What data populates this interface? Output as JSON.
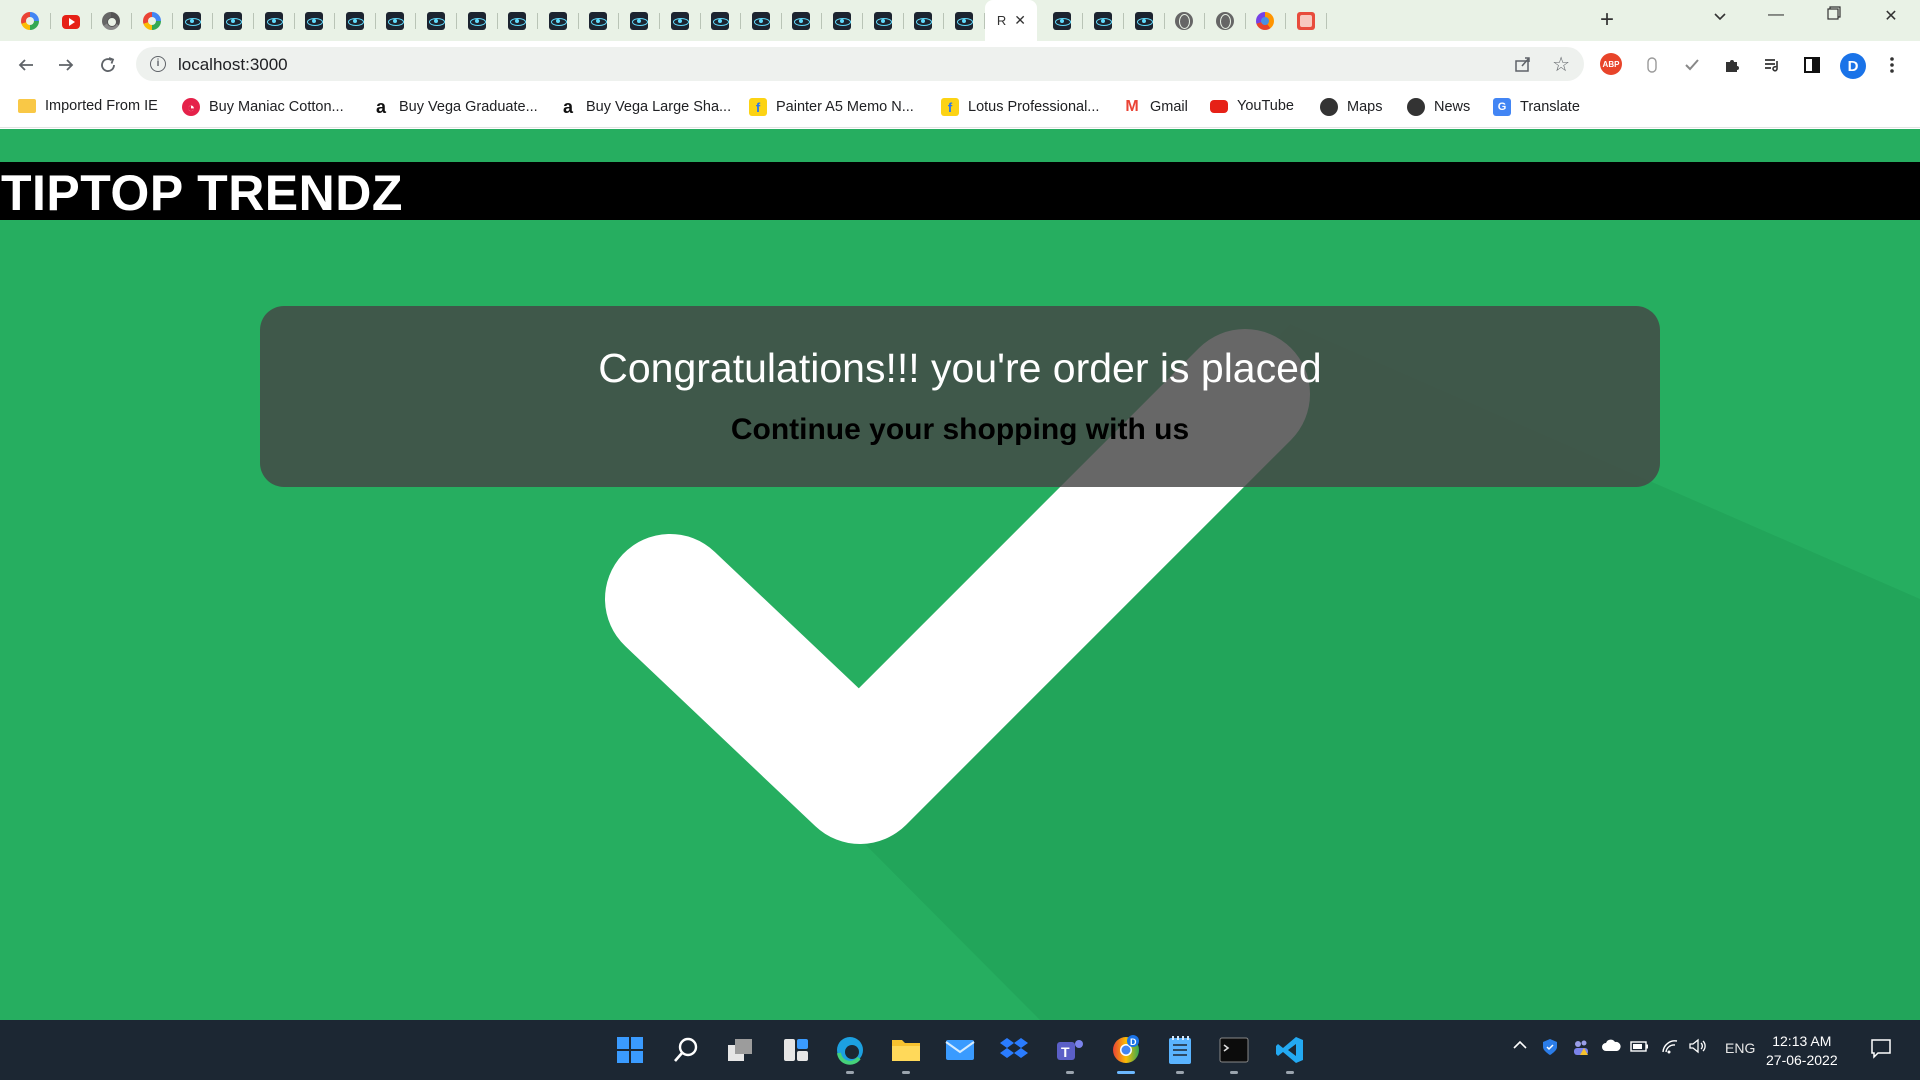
{
  "browser": {
    "tabs": [
      {
        "icon": "google-icon"
      },
      {
        "icon": "youtube-icon"
      },
      {
        "icon": "chrome-icon"
      },
      {
        "icon": "google-icon"
      },
      {
        "icon": "react-icon"
      },
      {
        "icon": "react-icon"
      },
      {
        "icon": "react-icon"
      },
      {
        "icon": "react-icon"
      },
      {
        "icon": "react-icon"
      },
      {
        "icon": "react-icon"
      },
      {
        "icon": "react-icon"
      },
      {
        "icon": "react-icon"
      },
      {
        "icon": "react-icon"
      },
      {
        "icon": "react-icon"
      },
      {
        "icon": "react-icon"
      },
      {
        "icon": "react-icon"
      },
      {
        "icon": "react-icon"
      },
      {
        "icon": "react-icon"
      },
      {
        "icon": "react-icon"
      },
      {
        "icon": "react-icon"
      },
      {
        "icon": "react-icon"
      },
      {
        "icon": "react-icon"
      },
      {
        "icon": "react-icon"
      },
      {
        "icon": "react-icon"
      }
    ],
    "active_tab": {
      "title": "R",
      "close": "✕"
    },
    "tabs_after": [
      {
        "icon": "react-icon"
      },
      {
        "icon": "react-icon"
      },
      {
        "icon": "react-icon"
      },
      {
        "icon": "globe-icon"
      },
      {
        "icon": "globe-icon"
      },
      {
        "icon": "firefox-icon"
      },
      {
        "icon": "photo-icon"
      }
    ],
    "new_tab": "+",
    "url": "localhost:3000",
    "profile_initial": "D",
    "abp_label": "ABP"
  },
  "bookmarks": [
    {
      "label": "Imported From IE",
      "icon": "folder-icon"
    },
    {
      "label": "Buy Maniac Cotton...",
      "icon": "maniac-icon"
    },
    {
      "label": "Buy Vega Graduate...",
      "icon": "amazon-icon"
    },
    {
      "label": "Buy Vega Large Sha...",
      "icon": "amazon-icon"
    },
    {
      "label": "Painter A5 Memo N...",
      "icon": "flipkart-icon"
    },
    {
      "label": "Lotus Professional...",
      "icon": "flipkart-icon"
    },
    {
      "label": "Gmail",
      "icon": "gmail-icon"
    },
    {
      "label": "YouTube",
      "icon": "youtube-icon"
    },
    {
      "label": "Maps",
      "icon": "globe-icon"
    },
    {
      "label": "News",
      "icon": "globe-icon"
    },
    {
      "label": "Translate",
      "icon": "translate-icon"
    }
  ],
  "page": {
    "brand": "TIPTOP TRENDZ",
    "heading": "Congratulations!!! you're order is placed",
    "subheading": "Continue your shopping with us",
    "background_color": "#26ae60"
  },
  "taskbar": {
    "apps": [
      "windows-start-icon",
      "search-icon",
      "task-view-icon",
      "widgets-icon",
      "edge-icon",
      "file-explorer-icon",
      "mail-icon",
      "dropbox-icon",
      "teams-icon",
      "chrome-icon",
      "notepad-icon",
      "terminal-icon",
      "vscode-icon"
    ],
    "language": "ENG",
    "time": "12:13 AM",
    "date": "27-06-2022"
  }
}
